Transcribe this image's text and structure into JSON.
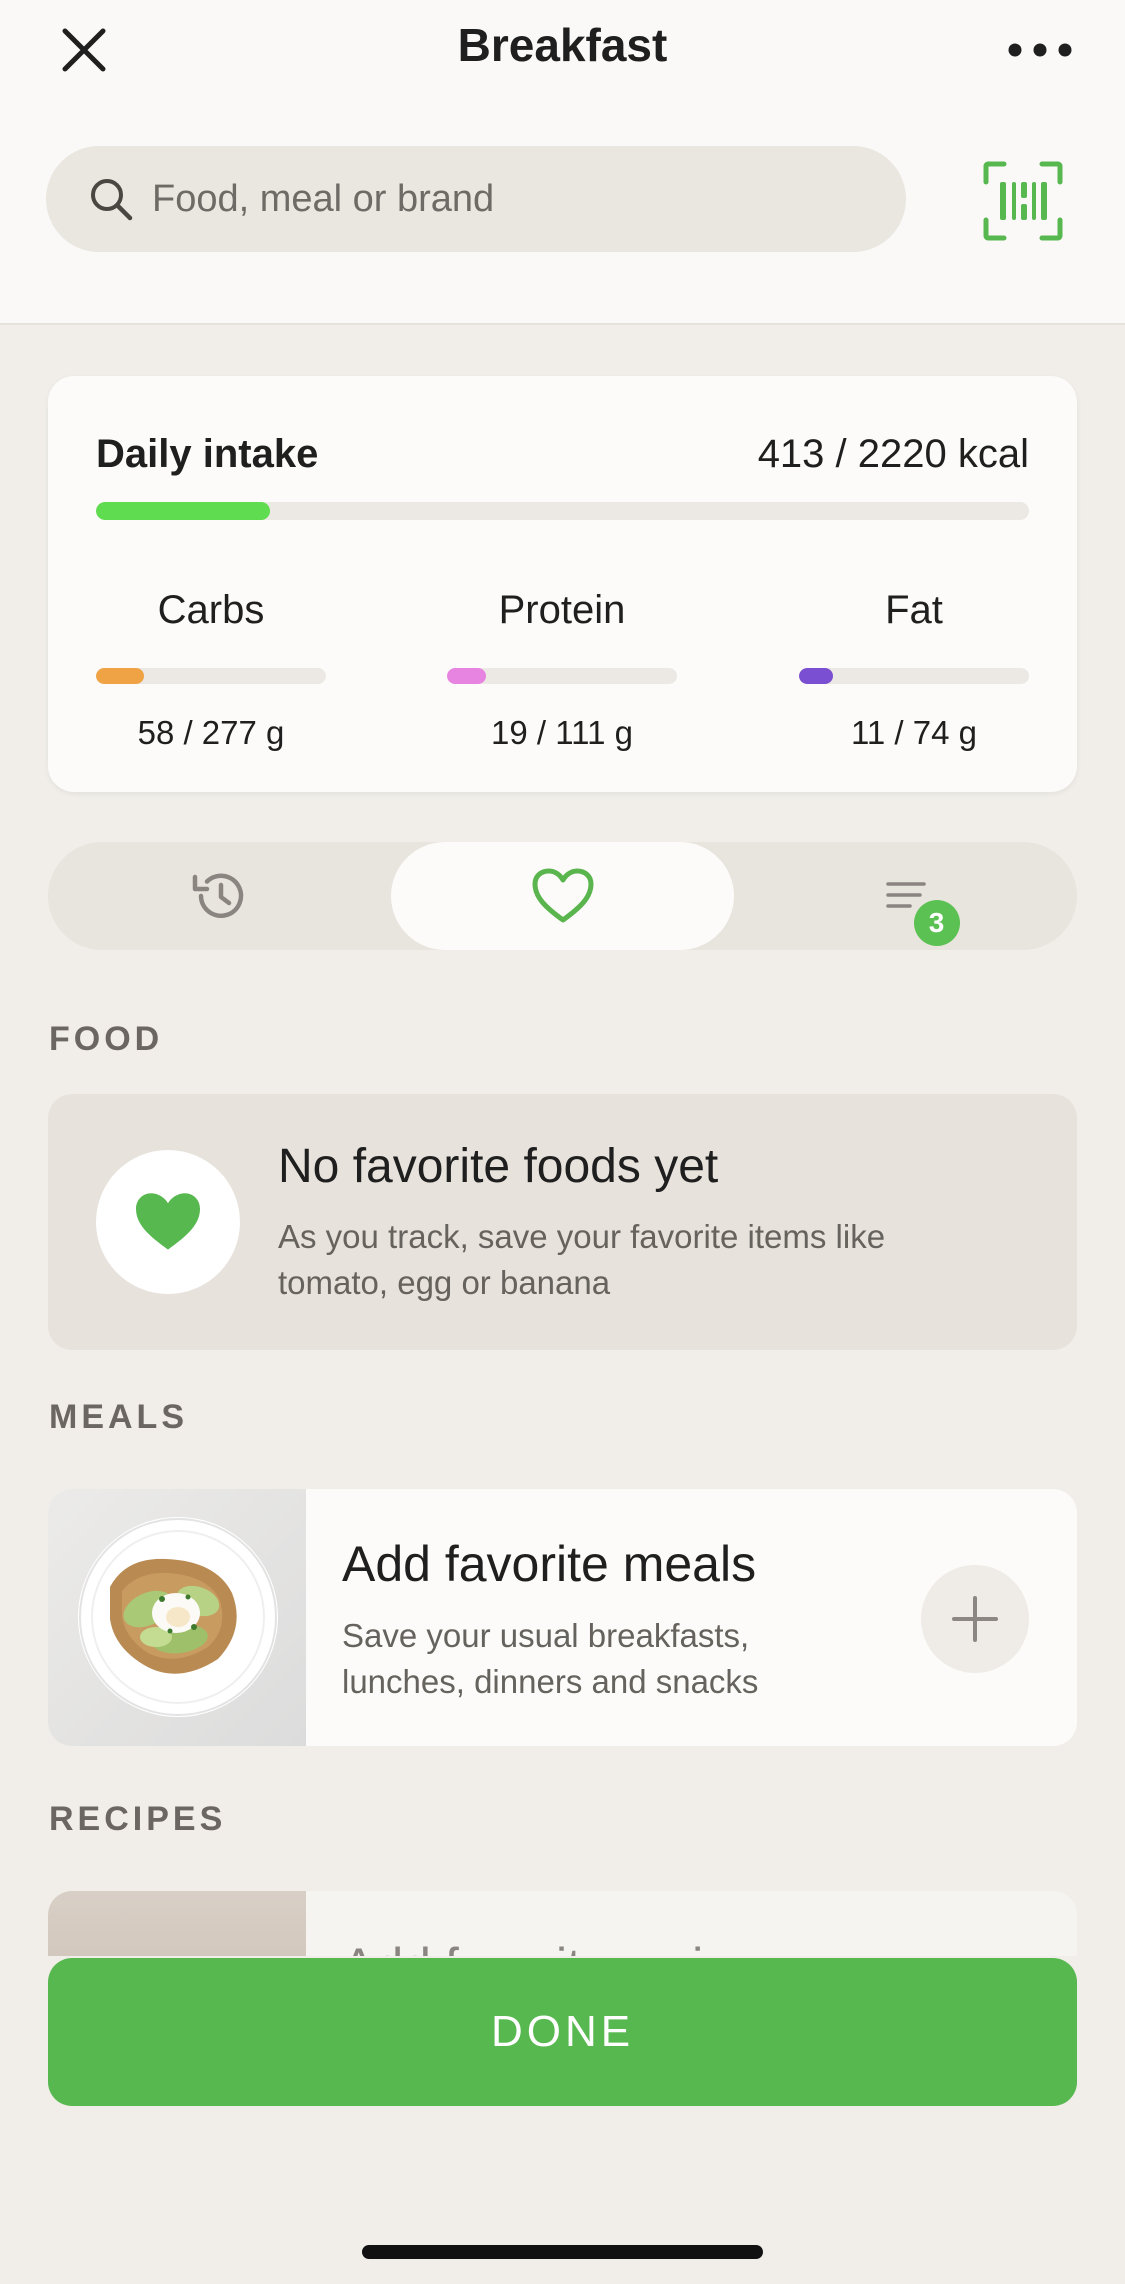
{
  "header": {
    "title": "Breakfast",
    "close_icon": "close-icon",
    "more_icon": "more-horizontal-icon"
  },
  "search": {
    "placeholder": "Food, meal or brand",
    "value": "",
    "icon": "search-icon",
    "barcode_icon": "barcode-scan-icon"
  },
  "daily_intake": {
    "title": "Daily intake",
    "kcal_text": "413 / 2220 kcal",
    "consumed_kcal": 413,
    "goal_kcal": 2220,
    "progress_fraction": 0.186,
    "bar_color": "#5fdc4f"
  },
  "macros": [
    {
      "name": "Carbs",
      "amount_text": "58 / 277 g",
      "fraction": 0.209,
      "color": "#f0a344"
    },
    {
      "name": "Protein",
      "amount_text": "19 / 111 g",
      "fraction": 0.171,
      "color": "#e783e1"
    },
    {
      "name": "Fat",
      "amount_text": "11 / 74 g",
      "fraction": 0.149,
      "color": "#7b4fd1"
    }
  ],
  "segments": {
    "items": [
      {
        "icon": "history-icon",
        "active": false
      },
      {
        "icon": "heart-outline-icon",
        "active": true
      },
      {
        "icon": "list-icon",
        "active": false,
        "badge": "3"
      }
    ],
    "badge_color": "#5bc152",
    "active_icon_color": "#5bb54e"
  },
  "sections": {
    "food_label": "FOOD",
    "meals_label": "MEALS",
    "recipes_label": "RECIPES"
  },
  "food_empty": {
    "title": "No favorite foods yet",
    "subtitle_line1": "As you track, save your favorite items like",
    "subtitle_line2": "tomato, egg or banana",
    "icon": "heart-filled-icon"
  },
  "meals_card": {
    "title": "Add favorite meals",
    "subtitle_line1": "Save your usual breakfasts,",
    "subtitle_line2": "lunches, dinners and snacks",
    "image_icon": "avocado-toast-image",
    "action_icon": "plus-icon"
  },
  "recipes_card": {
    "title": "Add favorite recipes",
    "image_icon": "recipe-image"
  },
  "done_button": {
    "label": "DONE",
    "color": "#58b850"
  }
}
